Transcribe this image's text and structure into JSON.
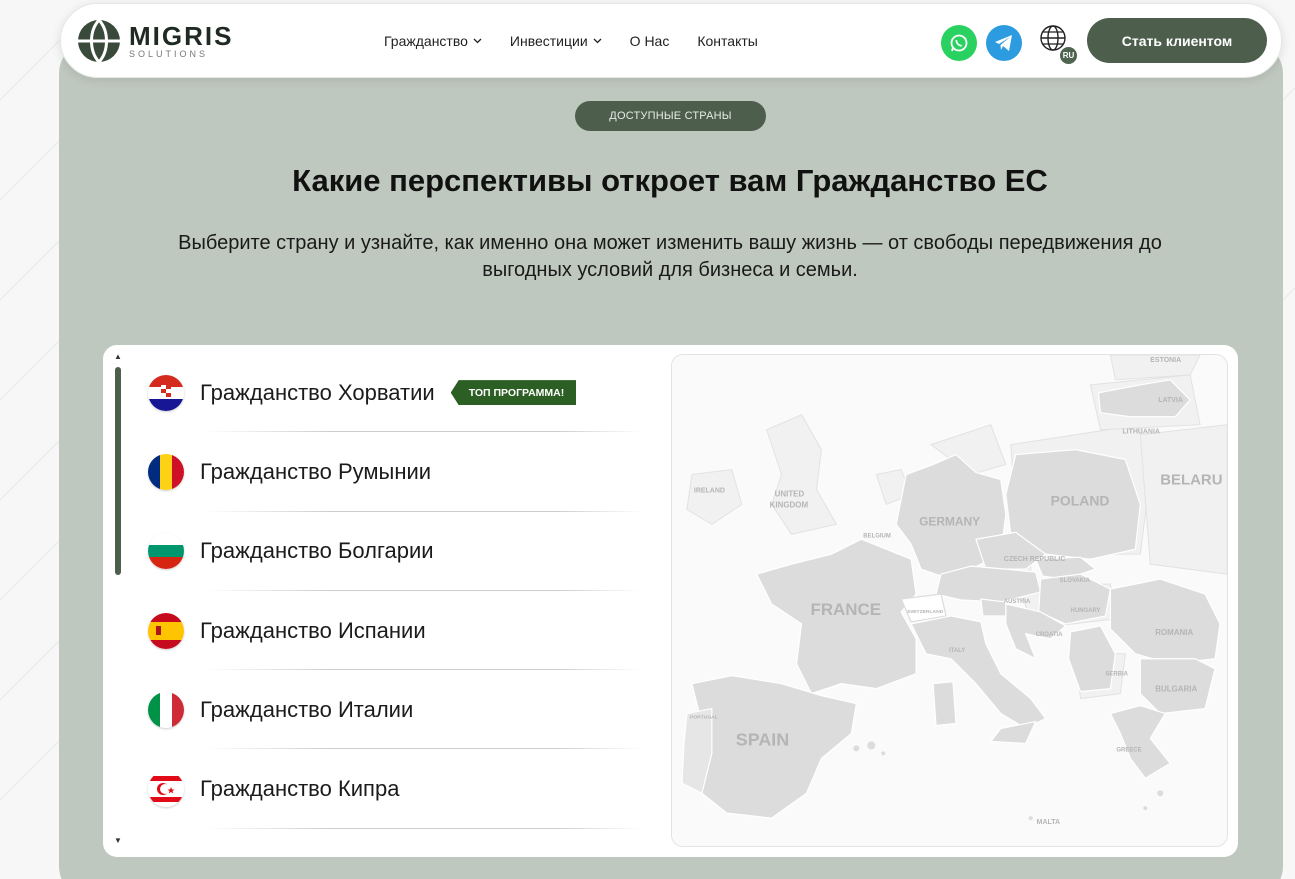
{
  "logo": {
    "name": "MIGRIS",
    "sub": "SOLUTIONS"
  },
  "nav": [
    {
      "label": "Гражданство",
      "dropdown": true
    },
    {
      "label": "Инвестиции",
      "dropdown": true
    },
    {
      "label": "О Нас",
      "dropdown": false
    },
    {
      "label": "Контакты",
      "dropdown": false
    }
  ],
  "header": {
    "lang": "RU",
    "cta": "Стать клиентом"
  },
  "section": {
    "pill": "ДОСТУПНЫЕ СТРАНЫ",
    "title": "Какие перспективы откроет вам Гражданство ЕС",
    "subtitle_line1": "Выберите страну и узнайте, как именно она может изменить вашу жизнь — от свободы передвижения до",
    "subtitle_line2": "выгодных условий для бизнеса и семьи."
  },
  "countries": [
    {
      "label": "Гражданство Хорватии",
      "badge": "ТОП ПРОГРАММА!",
      "flag": "croatia-flag"
    },
    {
      "label": "Гражданство Румынии",
      "flag": "romania-flag"
    },
    {
      "label": "Гражданство Болгарии",
      "flag": "bulgaria-flag"
    },
    {
      "label": "Гражданство Испании",
      "flag": "spain-flag"
    },
    {
      "label": "Гражданство Италии",
      "flag": "italy-flag"
    },
    {
      "label": "Гражданство Кипра",
      "flag": "cyprus-flag"
    }
  ],
  "map_labels": {
    "estonia": "ESTONIA",
    "latvia": "LATVIA",
    "lithuania": "LITHUANIA",
    "belarus": "BELARU",
    "ireland": "IRELAND",
    "uk_1": "UNITED",
    "uk_2": "KINGDOM",
    "poland": "POLAND",
    "germany": "GERMANY",
    "belgium": "BELGIUM",
    "czech": "CZECH REPUBLIC",
    "slovakia": "SLOVAKIA",
    "france": "FRANCE",
    "switzerland": "SWITZERLAND",
    "austria": "AUSTRIA",
    "hungary": "HUNGARY",
    "romania": "ROMANIA",
    "croatia": "CROATIA",
    "italy": "ITALY",
    "serbia": "SERBIA",
    "bulgaria": "BULGARIA",
    "spain": "SPAIN",
    "portugal": "PORTUGAL",
    "greece": "GREECE",
    "malta": "MALTA"
  },
  "colors": {
    "accent": "#4d5e4d",
    "panel": "#bfc8be",
    "whatsapp": "#29d160",
    "telegram": "#2c9be0",
    "badge": "#2c5f24"
  }
}
